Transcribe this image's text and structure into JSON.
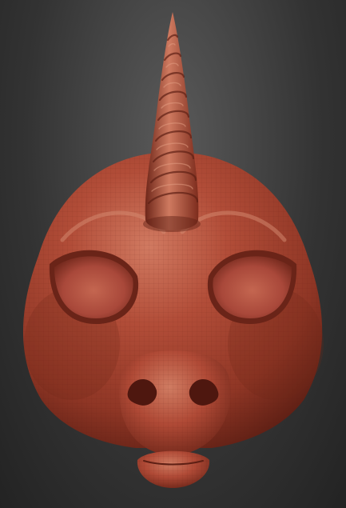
{
  "viewport": {
    "background_color": "#3a3a3a",
    "model": {
      "material_color": "#b04a36",
      "shadow_color": "#5a1d14",
      "highlight_color": "#d98a70",
      "wireframe_visible": true,
      "parts": [
        "horn",
        "head",
        "eye-sockets",
        "snout",
        "nostrils",
        "lower-lip"
      ]
    }
  }
}
